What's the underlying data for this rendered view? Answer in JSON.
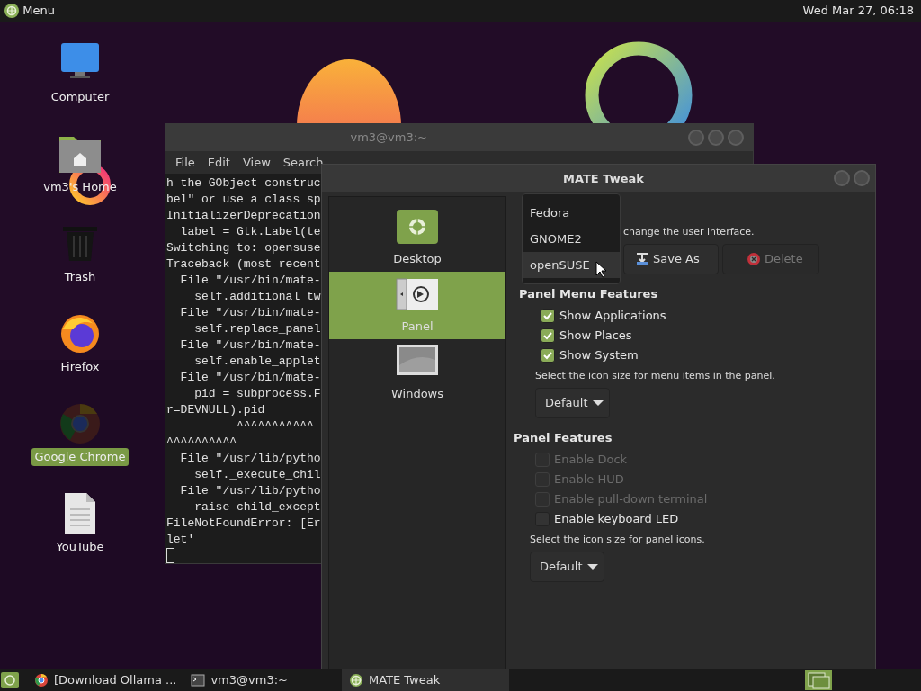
{
  "top_panel": {
    "menu_label": "Menu",
    "clock": "Wed Mar 27, 06:18"
  },
  "desktop_icons": [
    {
      "label": "Computer",
      "kind": "computer",
      "selected": false
    },
    {
      "label": "vm3's Home",
      "kind": "home",
      "selected": false
    },
    {
      "label": "Trash",
      "kind": "trash",
      "selected": false
    },
    {
      "label": "Firefox",
      "kind": "firefox",
      "selected": false
    },
    {
      "label": "Google Chrome",
      "kind": "chrome",
      "selected": true
    },
    {
      "label": "YouTube",
      "kind": "document",
      "selected": false
    }
  ],
  "terminal": {
    "title": "vm3@vm3:~",
    "menu": [
      "File",
      "Edit",
      "View",
      "Search"
    ],
    "lines": [
      "h the GObject construc",
      "bel\" or use a class sp",
      "InitializerDeprecation",
      "  label = Gtk.Label(te",
      "Switching to: opensuse",
      "Traceback (most recent",
      "  File \"/usr/bin/mate-",
      "    self.additional_tw",
      "  File \"/usr/bin/mate-",
      "    self.replace_panel",
      "  File \"/usr/bin/mate-",
      "    self.enable_applet",
      "  File \"/usr/bin/mate-",
      "    pid = subprocess.F",
      "r=DEVNULL).pid",
      "          ^^^^^^^^^^^",
      "^^^^^^^^^^",
      "  File \"/usr/lib/pytho",
      "    self._execute_chil",
      "  File \"/usr/lib/pytho",
      "    raise child_except",
      "FileNotFoundError: [Er",
      "let'"
    ]
  },
  "tweak": {
    "title": "MATE Tweak",
    "sidebar": [
      {
        "label": "Desktop",
        "kind": "desktop",
        "selected": false
      },
      {
        "label": "Panel",
        "kind": "panel",
        "selected": true
      },
      {
        "label": "Windows",
        "kind": "windows",
        "selected": false
      }
    ],
    "layout_hint": "change the user interface.",
    "buttons": [
      {
        "label": "Save As",
        "kind": "save",
        "disabled": false
      },
      {
        "label": "Delete",
        "kind": "delete",
        "disabled": true
      }
    ],
    "layout_menu": [
      {
        "label": "Fedora",
        "selected": false
      },
      {
        "label": "GNOME2",
        "selected": false
      },
      {
        "label": "openSUSE",
        "selected": true
      }
    ],
    "sections": [
      {
        "heading": "Panel Menu Features",
        "options": [
          {
            "label": "Show Applications",
            "checked": true,
            "disabled": false
          },
          {
            "label": "Show Places",
            "checked": true,
            "disabled": false
          },
          {
            "label": "Show System",
            "checked": true,
            "disabled": false
          }
        ],
        "hint": "Select the icon size for menu items in the panel.",
        "dropdown": "Default"
      },
      {
        "heading": "Panel Features",
        "options": [
          {
            "label": "Enable Dock",
            "checked": false,
            "disabled": true
          },
          {
            "label": "Enable HUD",
            "checked": false,
            "disabled": true
          },
          {
            "label": "Enable pull-down terminal",
            "checked": false,
            "disabled": true
          },
          {
            "label": "Enable keyboard LED",
            "checked": false,
            "disabled": false
          }
        ],
        "hint": "Select the icon size for panel icons.",
        "dropdown": "Default"
      }
    ]
  },
  "taskbar": {
    "items": [
      {
        "label": "[Download Ollama ...",
        "kind": "browser",
        "selected": false
      },
      {
        "label": "vm3@vm3:~",
        "kind": "terminal",
        "selected": false
      },
      {
        "label": "MATE Tweak",
        "kind": "tweak",
        "selected": true
      }
    ]
  }
}
